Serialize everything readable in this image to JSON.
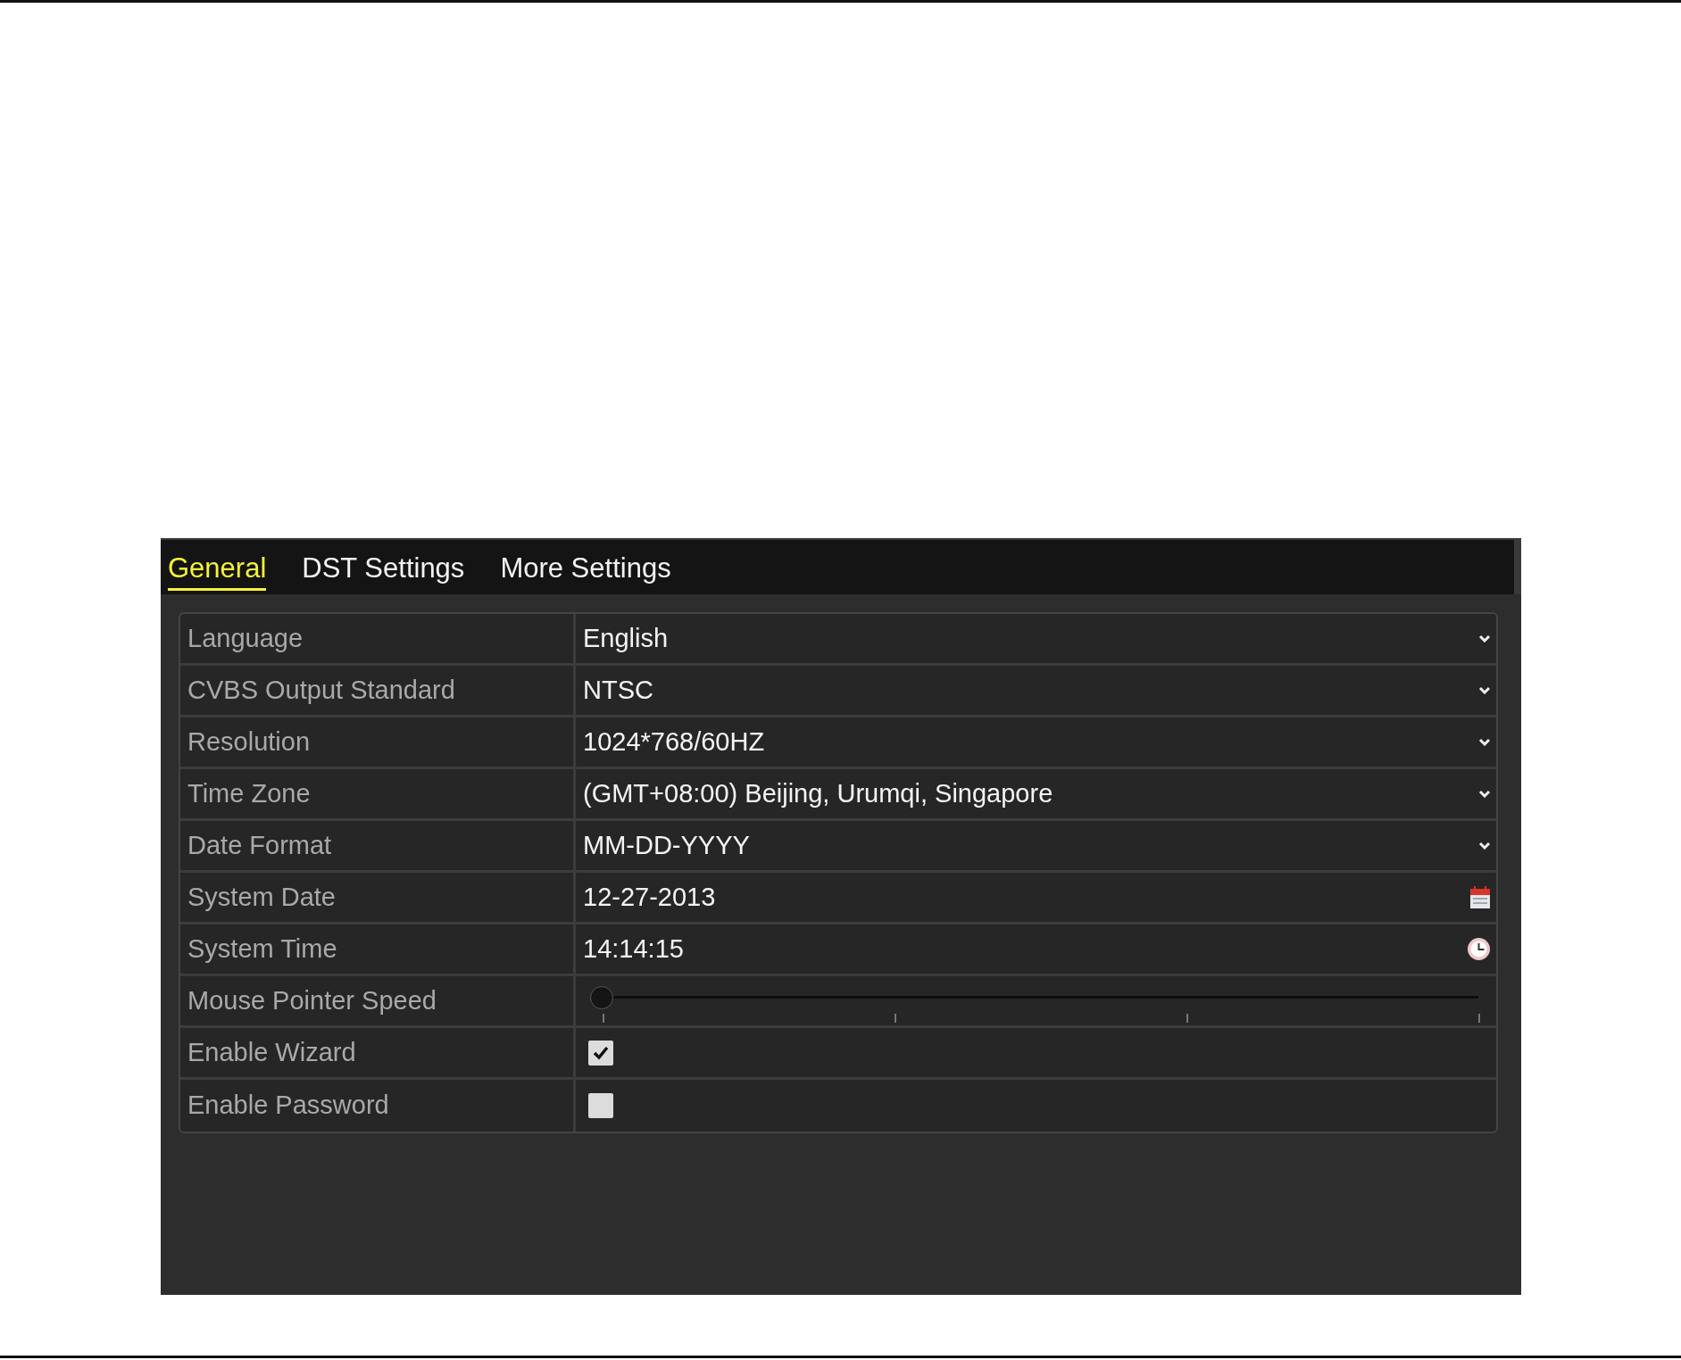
{
  "tabs": [
    {
      "label": "General",
      "selected": true
    },
    {
      "label": "DST Settings",
      "selected": false
    },
    {
      "label": "More Settings",
      "selected": false
    }
  ],
  "settings": [
    {
      "label": "Language",
      "kind": "select",
      "value": "English"
    },
    {
      "label": "CVBS Output Standard",
      "kind": "select",
      "value": "NTSC"
    },
    {
      "label": "Resolution",
      "kind": "select",
      "value": "1024*768/60HZ"
    },
    {
      "label": "Time Zone",
      "kind": "select",
      "value": "(GMT+08:00) Beijing, Urumqi, Singapore"
    },
    {
      "label": "Date Format",
      "kind": "select",
      "value": "MM-DD-YYYY"
    },
    {
      "label": "System Date",
      "kind": "date",
      "value": "12-27-2013"
    },
    {
      "label": "System Time",
      "kind": "time",
      "value": "14:14:15"
    },
    {
      "label": "Mouse Pointer Speed",
      "kind": "slider",
      "level": 0
    },
    {
      "label": "Enable Wizard",
      "kind": "checkbox",
      "checked": true
    },
    {
      "label": "Enable Password",
      "kind": "checkbox",
      "checked": false
    }
  ]
}
